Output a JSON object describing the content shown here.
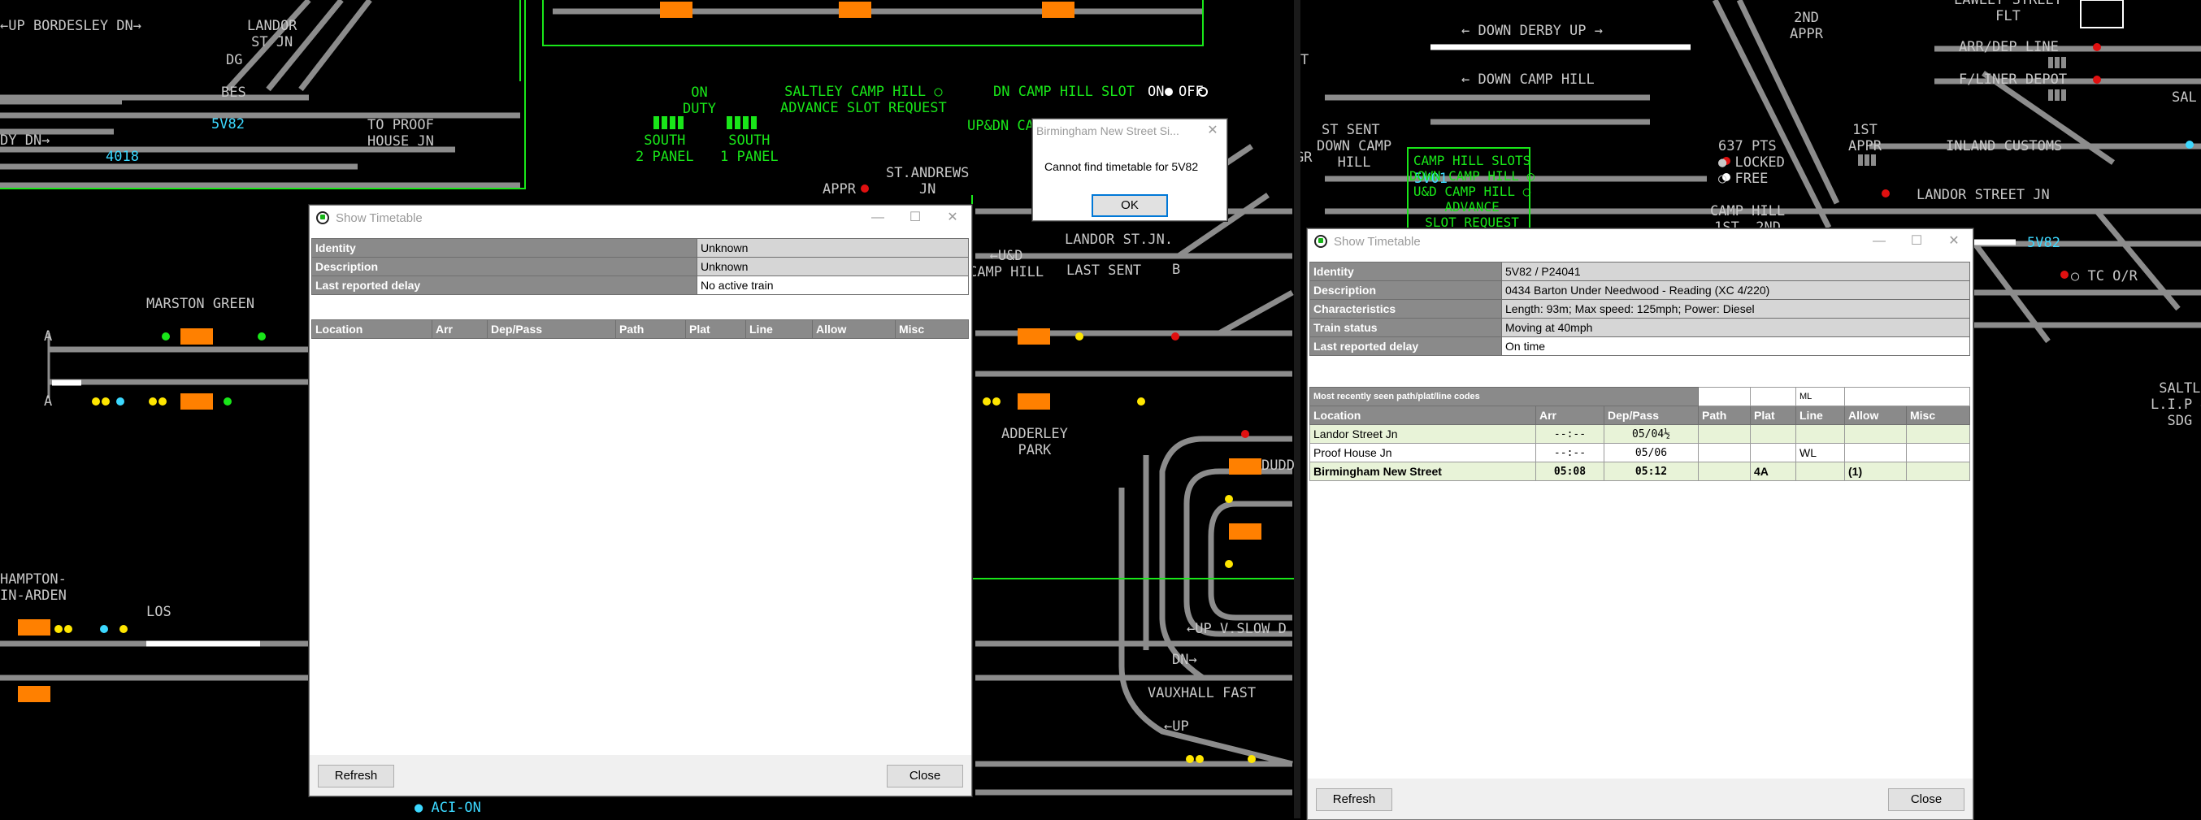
{
  "colors": {
    "desktop": "#000000",
    "track": "#8c8c8c",
    "highlight_track": "#ffffff",
    "orange": "#ff8000",
    "green_text": "#19e619",
    "cyan_text": "#3cd8ff",
    "signal_red": "#e01010",
    "signal_yellow": "#ffe600",
    "signal_green": "#19e619",
    "window_header": "#8a8a8a",
    "highlight_row": "#e8f3d8"
  },
  "left_panel": {
    "labels": {
      "up_bordesley": "←UP BORDESLEY DN→",
      "landor_st_jn": "LANDOR\nST JN",
      "dg": "DG",
      "bes": "BES",
      "to_proof_house": "TO PROOF\nHOUSE JN",
      "headcode_5v82": "5V82",
      "headcode_4018": "4018",
      "dn_arrow": "DY DN→",
      "on_duty": "ON\nDUTY",
      "south_2_panel": "SOUTH\n2 PANEL",
      "south_1_panel": "SOUTH\n1 PANEL",
      "saltley_slot": "SALTLEY CAMP HILL ○\nADVANCE SLOT REQUEST",
      "dn_camp_hill_slot": "DN CAMP HILL SLOT",
      "on": "ON",
      "off": "OFF",
      "ud_cam": "UP&DN CA",
      "st_andrews": "ST.ANDREWS\nJN",
      "appr": "APPR",
      "landor_st_jn2": "LANDOR ST.JN.",
      "ud_camp_hill": "←U&D\nCAMP HILL",
      "last_sent": "LAST SENT",
      "b": "B",
      "marston_green": "MARSTON GREEN",
      "a1": "A",
      "a2": "A",
      "adderley_park": "ADDERLEY\nPARK",
      "hampton_in_arden": "HAMPTON-\nIN-ARDEN",
      "los": "LOS",
      "up_v_slow": "←UP V.SLOW D",
      "vauxhall_fast": "VAUXHALL FAST",
      "up": "←UP",
      "dn": "DN→",
      "dudd": "DUDD",
      "aci_on": "● ACI-ON"
    }
  },
  "right_panel": {
    "labels": {
      "down_derby_up": "← DOWN DERBY UP →",
      "down_camp_hill": "← DOWN CAMP HILL",
      "appr_2nd": "2ND\nAPPR",
      "lawley_flt": "LAWLEY STREET\nFLT",
      "arr_dep_line": "ARR/DEP LINE",
      "f_liner_depot": "F/LINER DEPOT",
      "sal": "SAL",
      "st_sent": "ST SENT",
      "down_camp_hill2": "DOWN CAMP\nHILL",
      "headcode_5v01": "5V01",
      "camp_hill_slots": "CAMP HILL SLOTS\nDOWN CAMP HILL ○\nU&D CAMP HILL ○\nADVANCE\nSLOT REQUEST",
      "pts_637": "637 PTS",
      "locked": "● LOCKED",
      "free": "○ FREE",
      "appr_1st": "1ST\nAPPR",
      "inland_customs": "INLAND CUSTOMS",
      "landor_street_jn": "LANDOR STREET JN",
      "camp_hill_1st_2nd": "CAMP HILL\n1ST  2ND",
      "headcode_5v82": "5V82",
      "tc_or": "○ TC O/R",
      "salt_lip": "SALTL\nL.I.P &\nSDG",
      "gr": "GR",
      "t": "T"
    }
  },
  "alert_dialog": {
    "title": "Birmingham New Street Si...",
    "message": "Cannot find timetable for 5V82",
    "ok_label": "OK"
  },
  "window_left": {
    "title": "Show Timetable",
    "identity_label": "Identity",
    "identity_value": "Unknown",
    "description_label": "Description",
    "description_value": "Unknown",
    "delay_label": "Last reported delay",
    "delay_value": "No active train",
    "columns": [
      "Location",
      "Arr",
      "Dep/Pass",
      "Path",
      "Plat",
      "Line",
      "Allow",
      "Misc"
    ],
    "refresh_label": "Refresh",
    "close_label": "Close"
  },
  "window_right": {
    "title": "Show Timetable",
    "identity_label": "Identity",
    "identity_value": "5V82 / P24041",
    "description_label": "Description",
    "description_value": "0434 Barton Under Needwood - Reading (XC 4/220)",
    "characteristics_label": "Characteristics",
    "characteristics_value": "Length: 93m; Max speed: 125mph; Power: Diesel",
    "status_label": "Train status",
    "status_value": "Moving at 40mph",
    "delay_label": "Last reported delay",
    "delay_value": "On time",
    "recent_codes_label": "Most recently seen path/plat/line codes",
    "recent_line_code": "ML",
    "columns": [
      "Location",
      "Arr",
      "Dep/Pass",
      "Path",
      "Plat",
      "Line",
      "Allow",
      "Misc"
    ],
    "rows": [
      {
        "location": "Landor Street Jn",
        "arr": "--:--",
        "dep": "05/04½",
        "path": "",
        "plat": "",
        "line": "",
        "allow": "",
        "misc": ""
      },
      {
        "location": "Proof House Jn",
        "arr": "--:--",
        "dep": "05/06",
        "path": "",
        "plat": "",
        "line": "WL",
        "allow": "",
        "misc": ""
      },
      {
        "location": "Birmingham New Street",
        "arr": "05:08",
        "dep": "05:12",
        "path": "",
        "plat": "4A",
        "line": "",
        "allow": "(1)",
        "misc": ""
      }
    ],
    "refresh_label": "Refresh",
    "close_label": "Close"
  }
}
